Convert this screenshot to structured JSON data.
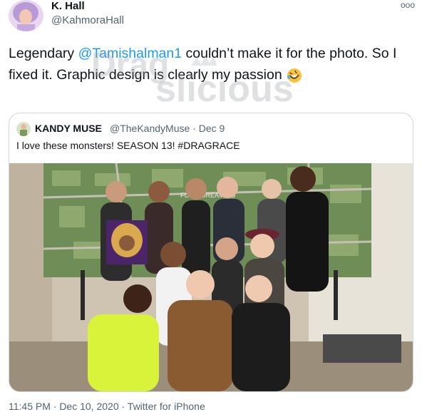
{
  "author": {
    "display_name": "K. Hall",
    "handle": "@KahmoraHall",
    "avatar_icon": "profile-avatar"
  },
  "more_icon": "ooo",
  "tweet": {
    "text_prefix": "Legendary ",
    "mention": "@Tamishalman1",
    "text_suffix": " couldn’t make it for the photo. So I fixed it. Graphic design is clearly my passion",
    "emoji": "rolling-on-floor-laughing-emoji"
  },
  "watermark": {
    "text_line1": "Drag",
    "text_line2": "slicious"
  },
  "quoted_tweet": {
    "display_name": "KANDY MUSE",
    "handle_date": "@TheKandyMuse · Dec 9",
    "text": "I love these monsters! SEASON 13! #DRAGRACE",
    "photo_icon": "group-photo",
    "sign_text": "FOR A DREAMING"
  },
  "footer": {
    "timestamp": "11:45 PM · Dec 10, 2020 · Twitter for iPhone"
  },
  "colors": {
    "link": "#1d9bf0",
    "secondary": "#536471",
    "border": "#cfd9de"
  }
}
